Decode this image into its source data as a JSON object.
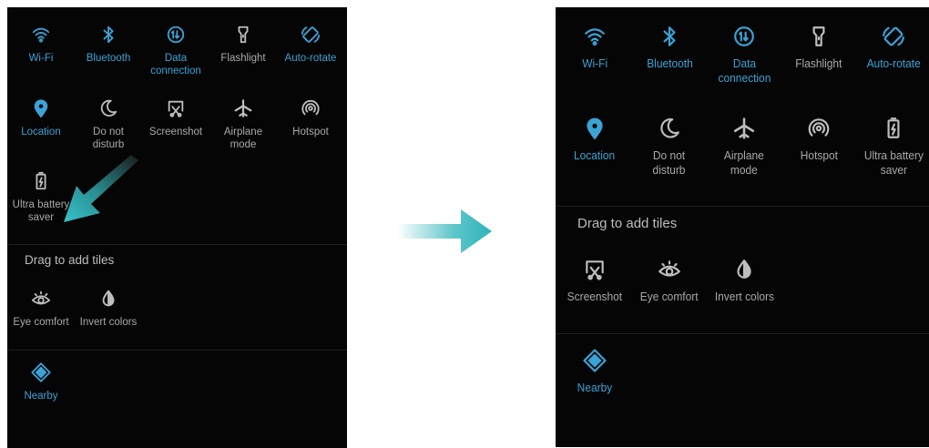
{
  "before": {
    "active_tiles": [
      {
        "label": "Wi-Fi",
        "icon": "wifi-icon",
        "state": "on"
      },
      {
        "label": "Bluetooth",
        "icon": "bluetooth-icon",
        "state": "on"
      },
      {
        "label": "Data\nconnection",
        "icon": "data-connection-icon",
        "state": "on"
      },
      {
        "label": "Flashlight",
        "icon": "flashlight-icon",
        "state": "off"
      },
      {
        "label": "Auto-rotate",
        "icon": "auto-rotate-icon",
        "state": "on"
      },
      {
        "label": "Location",
        "icon": "location-icon",
        "state": "on"
      },
      {
        "label": "Do not\ndisturb",
        "icon": "moon-icon",
        "state": "off"
      },
      {
        "label": "Screenshot",
        "icon": "screenshot-icon",
        "state": "off"
      },
      {
        "label": "Airplane\nmode",
        "icon": "airplane-icon",
        "state": "off"
      },
      {
        "label": "Hotspot",
        "icon": "hotspot-icon",
        "state": "off"
      },
      {
        "label": "Ultra battery\nsaver",
        "icon": "battery-icon",
        "state": "off"
      }
    ],
    "drag_title": "Drag to add tiles",
    "inactive_tiles": [
      {
        "label": "Eye comfort",
        "icon": "eye-icon",
        "state": "off"
      },
      {
        "label": "Invert colors",
        "icon": "invert-colors-icon",
        "state": "off"
      }
    ],
    "extra_tiles": [
      {
        "label": "Nearby",
        "icon": "nearby-icon",
        "state": "on"
      }
    ]
  },
  "after": {
    "active_tiles": [
      {
        "label": "Wi-Fi",
        "icon": "wifi-icon",
        "state": "on"
      },
      {
        "label": "Bluetooth",
        "icon": "bluetooth-icon",
        "state": "on"
      },
      {
        "label": "Data\nconnection",
        "icon": "data-connection-icon",
        "state": "on"
      },
      {
        "label": "Flashlight",
        "icon": "flashlight-icon",
        "state": "off"
      },
      {
        "label": "Auto-rotate",
        "icon": "auto-rotate-icon",
        "state": "on"
      },
      {
        "label": "Location",
        "icon": "location-icon",
        "state": "on"
      },
      {
        "label": "Do not\ndisturb",
        "icon": "moon-icon",
        "state": "off"
      },
      {
        "label": "Airplane\nmode",
        "icon": "airplane-icon",
        "state": "off"
      },
      {
        "label": "Hotspot",
        "icon": "hotspot-icon",
        "state": "off"
      },
      {
        "label": "Ultra battery\nsaver",
        "icon": "battery-icon",
        "state": "off"
      }
    ],
    "drag_title": "Drag to add tiles",
    "inactive_tiles": [
      {
        "label": "Screenshot",
        "icon": "screenshot-icon",
        "state": "off"
      },
      {
        "label": "Eye comfort",
        "icon": "eye-icon",
        "state": "off"
      },
      {
        "label": "Invert colors",
        "icon": "invert-colors-icon",
        "state": "off"
      }
    ],
    "extra_tiles": [
      {
        "label": "Nearby",
        "icon": "nearby-icon",
        "state": "on"
      }
    ]
  },
  "colors": {
    "panel_bg": "#050505",
    "active_blue": "#3ba3d6",
    "inactive_grey": "#bdbdbd",
    "arrow_teal": "#2fb3b8"
  }
}
